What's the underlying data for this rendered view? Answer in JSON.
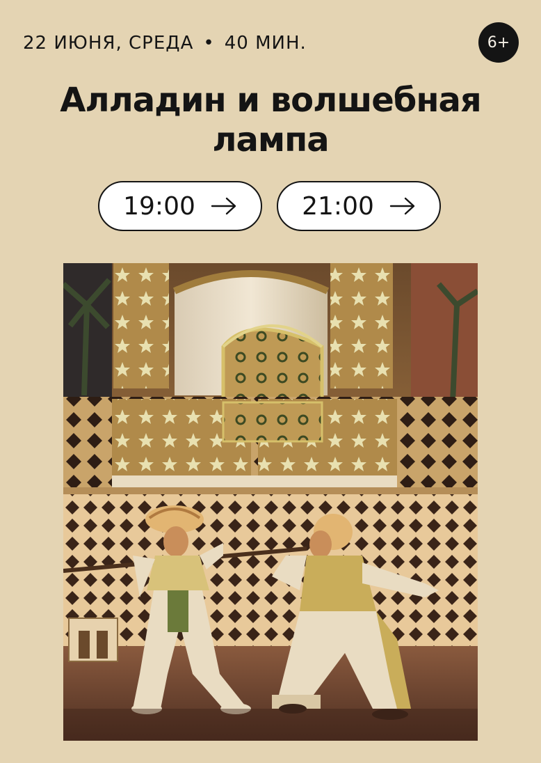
{
  "event": {
    "date": "22 ИЮНЯ, СРЕДА",
    "separator": "•",
    "duration": "40 МИН.",
    "age_rating": "6+",
    "title_line1": "Алладин и волшебная",
    "title_line2": "лампа"
  },
  "showtimes": [
    {
      "time": "19:00",
      "icon": "arrow-right-icon"
    },
    {
      "time": "21:00",
      "icon": "arrow-right-icon"
    }
  ],
  "colors": {
    "background": "#e4d4b3",
    "text": "#141414",
    "badge_bg": "#141414",
    "button_bg": "#ffffff"
  }
}
